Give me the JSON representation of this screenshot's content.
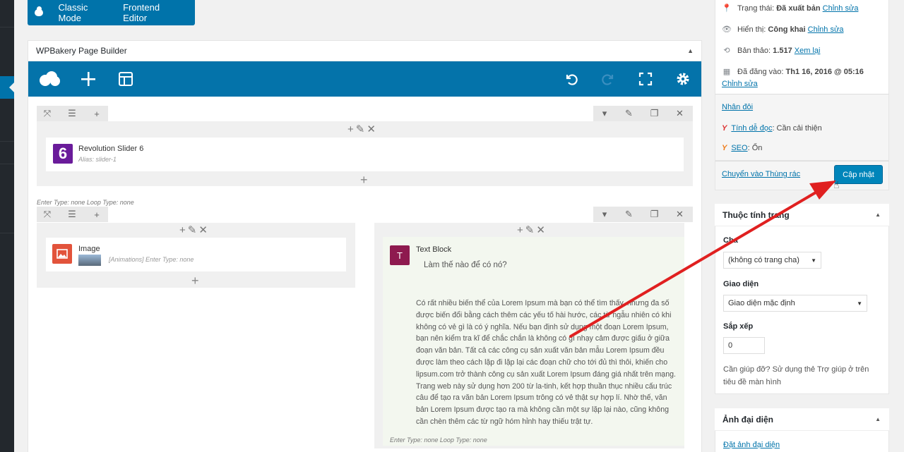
{
  "mode_bar": {
    "classic": "Classic Mode",
    "frontend": "Frontend Editor"
  },
  "builder": {
    "title": "WPBakery Page Builder",
    "rows": [
      {
        "elements": [
          {
            "title": "Revolution Slider 6",
            "subtitle": "Alias: slider-1",
            "logo_text": "6"
          }
        ],
        "meta": "Enter Type: none  Loop Type: none"
      }
    ],
    "image_el": {
      "title": "Image",
      "meta": "[Animations] Enter Type: none"
    },
    "text_el": {
      "title": "Text Block",
      "heading": "Làm thế nào để có nó?",
      "paragraph": "Có rất nhiều biến thể của Lorem Ipsum mà bạn có thể tìm thấy, nhưng đa số được biến đổi bằng cách thêm các yếu tố hài hước, các từ ngẫu nhiên có khi không có vẻ gì là có ý nghĩa. Nếu bạn định sử dụng một đoạn Lorem Ipsum, bạn nên kiểm tra kĩ để chắc chắn là không có gì nhạy cảm được giấu ở giữa đoạn văn bản. Tất cả các công cụ sản xuất văn bản mẫu Lorem Ipsum đều được làm theo cách lặp đi lặp lại các đoạn chữ cho tới đủ thì thôi, khiến cho lipsum.com trở thành công cụ sản xuất Lorem Ipsum đáng giá nhất trên mạng. Trang web này sử dụng hơn 200 từ la-tinh, kết hợp thuần thục nhiều cấu trúc câu để tạo ra văn bản Lorem Ipsum trông có vẻ thật sự hợp lí. Nhờ thế, văn bản Lorem Ipsum được tạo ra mà không cần một sự lặp lại nào, cũng không cần chèn thêm các từ ngữ hóm hỉnh hay thiếu trật tự.",
      "meta": "Enter Type: none     Loop Type: none",
      "logo_text": "T"
    }
  },
  "publish": {
    "status_label": "Trạng thái: ",
    "status_value": "Đã xuất bản",
    "status_edit": "Chỉnh sửa",
    "visibility_label": "Hiển thị: ",
    "visibility_value": "Công khai",
    "visibility_edit": "Chỉnh sửa",
    "revisions_label": "Bản thảo: ",
    "revisions_value": "1.517",
    "revisions_link": "Xem lại",
    "published_label": "Đã đăng vào: ",
    "published_value": "Th1 16, 2016 @ 05:16",
    "published_edit": "Chỉnh sửa",
    "duplicate": "Nhân đôi",
    "readability_link": "Tính dễ đọc",
    "readability_value": ": Cần cải thiện",
    "seo_link": "SEO",
    "seo_value": ": Ổn",
    "trash": "Chuyển vào Thùng rác",
    "update": "Cập nhật"
  },
  "page_attrs": {
    "title": "Thuộc tính trang",
    "parent_label": "Cha",
    "parent_value": "(không có trang cha)",
    "template_label": "Giao diện",
    "template_value": "Giao diện mặc định",
    "order_label": "Sắp xếp",
    "order_value": "0",
    "help": "Cần giúp đỡ? Sử dụng thẻ Trợ giúp ở trên tiêu đề màn hình"
  },
  "featured": {
    "title": "Ảnh đại diện",
    "link": "Đặt ảnh đại diện"
  },
  "colors": {
    "accent": "#0073aa",
    "arrow": "#e02020"
  }
}
